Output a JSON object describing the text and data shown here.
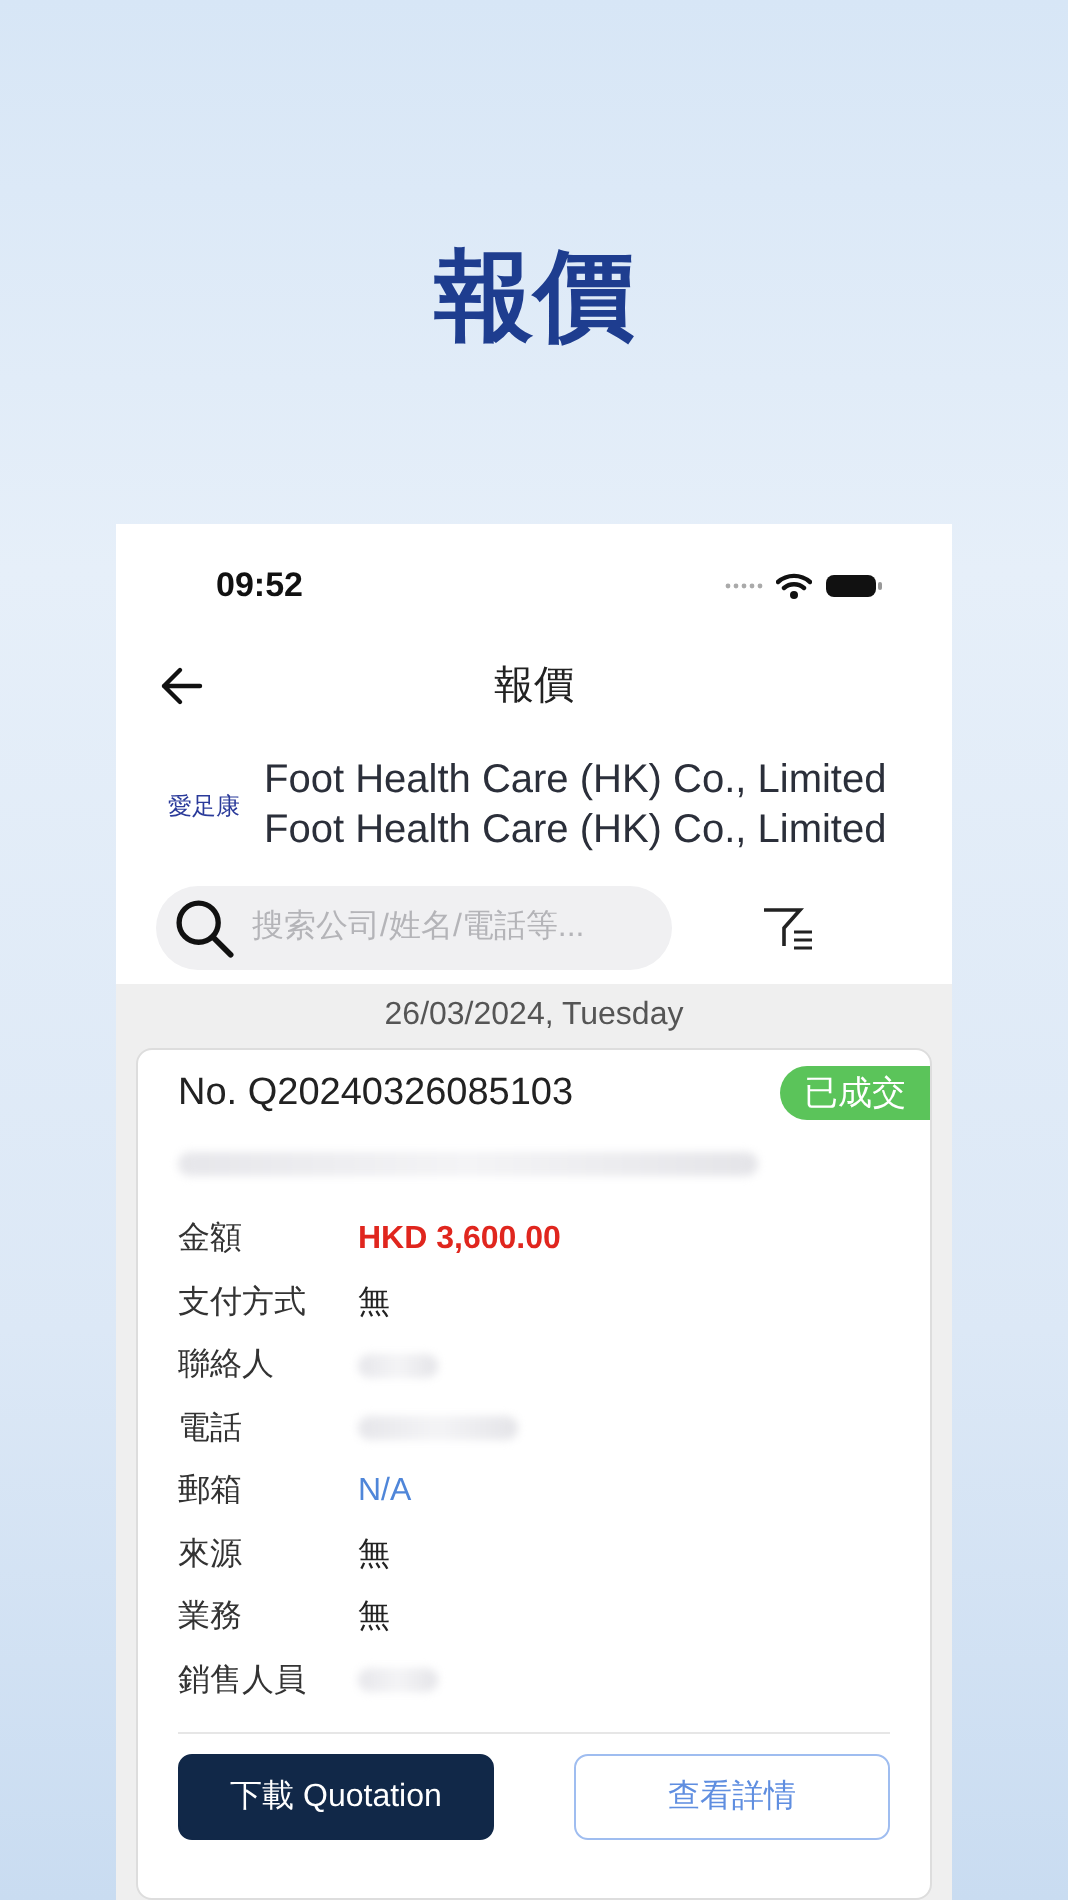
{
  "headline": "報價",
  "status_bar": {
    "time": "09:52"
  },
  "nav": {
    "title": "報價"
  },
  "company": {
    "logo_text": "愛足康",
    "names": [
      "Foot Health Care (HK) Co., Limited",
      "Foot Health Care (HK) Co., Limited"
    ]
  },
  "search": {
    "placeholder": "搜索公司/姓名/電話等..."
  },
  "date_header": "26/03/2024, Tuesday",
  "quote": {
    "number": "No. Q20240326085103",
    "status": "已成交",
    "fields": [
      {
        "label": "金額",
        "kind": "amount",
        "value": "HKD 3,600.00"
      },
      {
        "label": "支付方式",
        "kind": "plain",
        "value": "無"
      },
      {
        "label": "聯絡人",
        "kind": "hidden"
      },
      {
        "label": "電話",
        "kind": "hidden_link"
      },
      {
        "label": "郵箱",
        "kind": "link",
        "value": "N/A"
      },
      {
        "label": "來源",
        "kind": "plain",
        "value": "無"
      },
      {
        "label": "業務",
        "kind": "plain",
        "value": "無"
      },
      {
        "label": "銷售人員",
        "kind": "hidden"
      }
    ],
    "buttons": [
      {
        "label": "下載 Quotation",
        "kind": "primary"
      },
      {
        "label": "查看詳情",
        "kind": "outline"
      }
    ]
  }
}
